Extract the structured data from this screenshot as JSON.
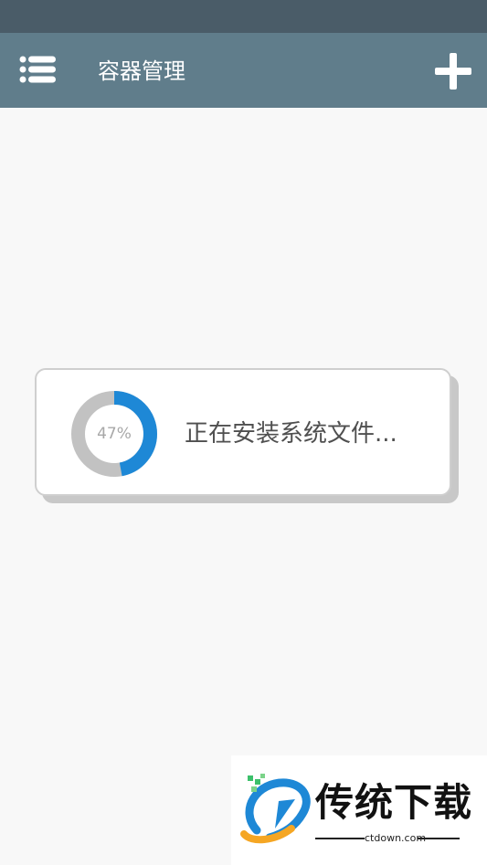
{
  "app_bar": {
    "title": "容器管理",
    "menu_icon": "list-menu-icon",
    "add_icon": "plus-icon",
    "color": "#607d8b",
    "status_bar_color": "#4a5c68"
  },
  "progress_dialog": {
    "percent": 47,
    "percent_label": "47%",
    "message": "正在安装系统文件...",
    "ring_color": "#1e88d6",
    "track_color": "#c2c2c2"
  },
  "watermark": {
    "title": "传统下载",
    "subtitle": "ctdown.com"
  }
}
